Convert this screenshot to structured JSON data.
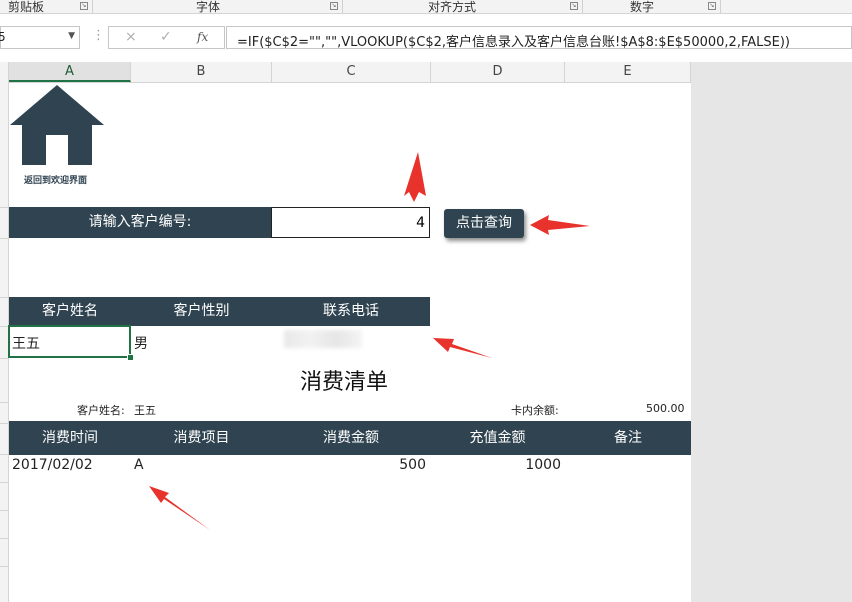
{
  "ribbon": {
    "groups": [
      {
        "label": "剪贴板"
      },
      {
        "label": "字体"
      },
      {
        "label": "对齐方式"
      },
      {
        "label": "数字"
      }
    ]
  },
  "formula_bar": {
    "name_box": "5",
    "cancel_icon": "×",
    "enter_icon": "✓",
    "fx_label": "fx",
    "formula": "=IF($C$2=\"\",\"\",VLOOKUP($C$2,客户信息录入及客户信息台账!$A$8:$E$50000,2,FALSE))"
  },
  "columns": [
    "A",
    "B",
    "C",
    "D",
    "E"
  ],
  "home": {
    "label": "返回到欢迎界面"
  },
  "query": {
    "prompt": "请输入客户编号:",
    "value": "4",
    "button": "点击查询"
  },
  "customer_table": {
    "headers": [
      "客户姓名",
      "客户性别",
      "联系电话"
    ],
    "row": {
      "name": "王五",
      "gender": "男",
      "phone": ""
    }
  },
  "consumption": {
    "title": "消费清单",
    "name_label": "客户姓名:",
    "name_value": "王五",
    "balance_label": "卡内余额:",
    "balance_value": "500.00",
    "headers": [
      "消费时间",
      "消费项目",
      "消费金额",
      "充值金额",
      "备注"
    ],
    "rows": [
      {
        "time": "2017/02/02",
        "item": "A",
        "amount": "500",
        "recharge": "1000",
        "note": ""
      }
    ]
  },
  "colors": {
    "dark_bar": "#2f4350",
    "arrow": "#e8322c",
    "selection": "#217346"
  }
}
